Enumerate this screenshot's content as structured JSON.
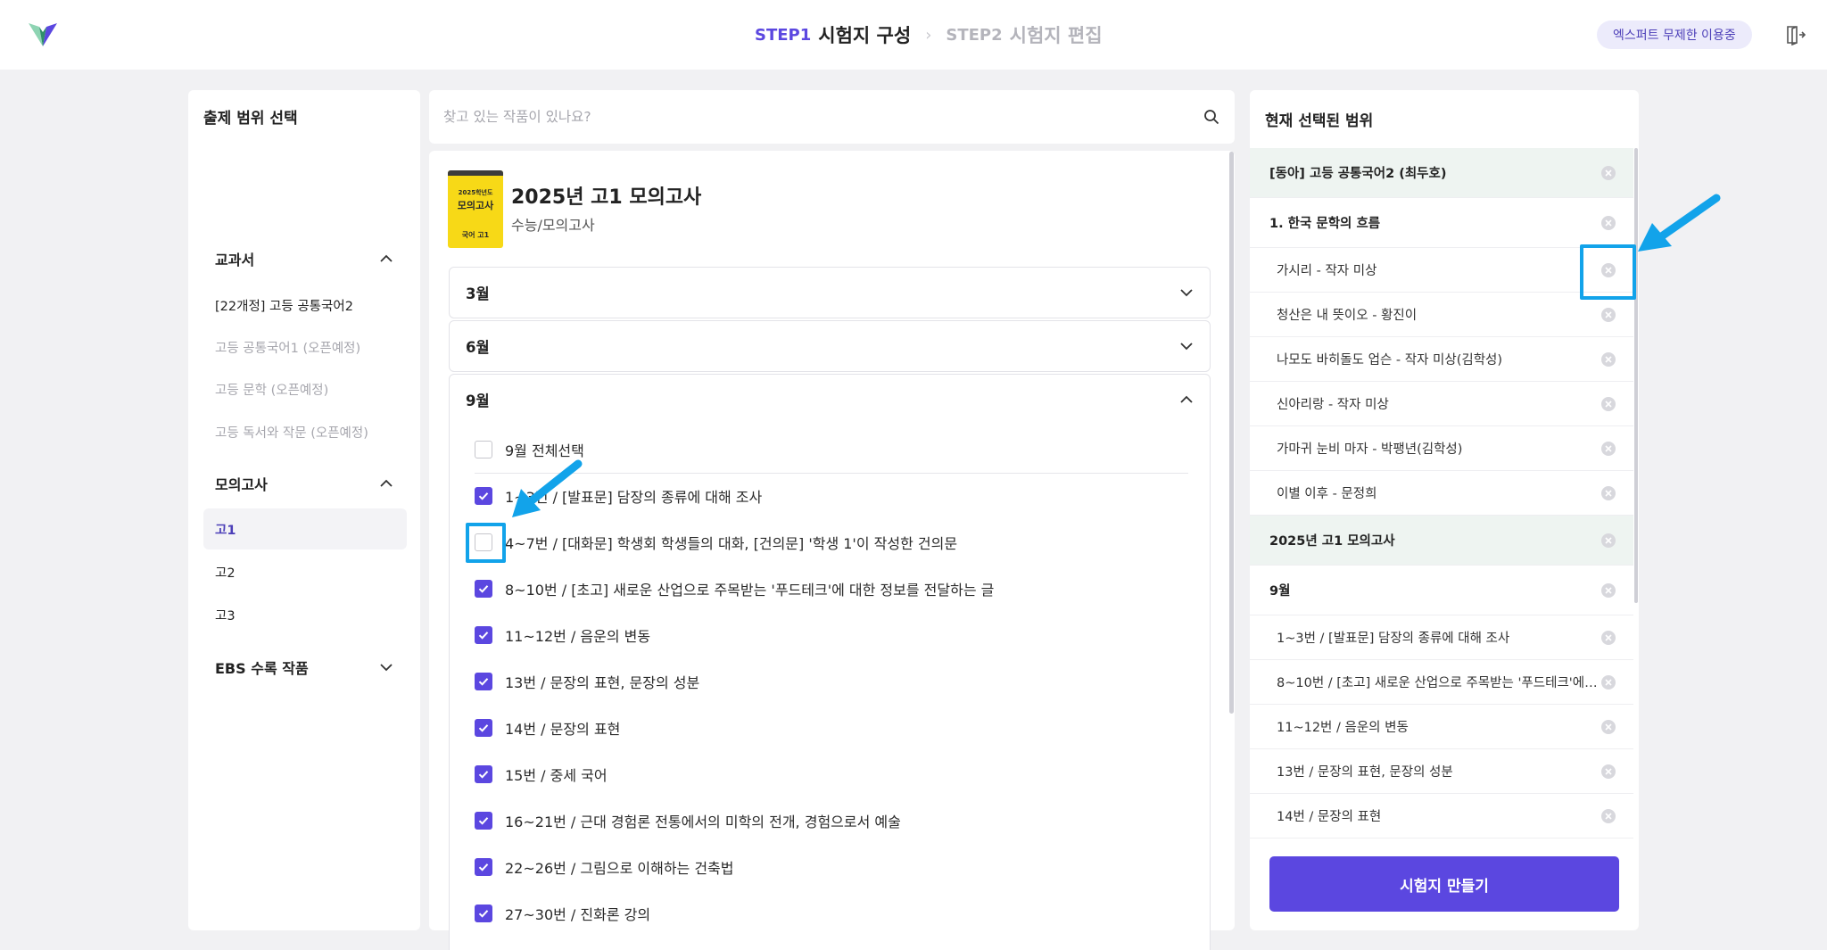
{
  "header": {
    "step1_num": "STEP1",
    "step1_label": "시험지 구성",
    "step2_num": "STEP2",
    "step2_label": "시험지 편집",
    "plan_badge": "엑스퍼트 무제한 이용중"
  },
  "left": {
    "title": "출제 범위 선택",
    "textbook_title": "교과서",
    "textbook_items": [
      "[22개정] 고등 공통국어2",
      "고등 공통국어1 (오픈예정)",
      "고등 문학 (오픈예정)",
      "고등 독서와 작문 (오픈예정)"
    ],
    "mock_title": "모의고사",
    "mock_items": [
      "고1",
      "고2",
      "고3"
    ],
    "ebs_title": "EBS 수록 작품"
  },
  "search": {
    "placeholder": "찾고 있는 작품이 있나요?"
  },
  "book": {
    "cover_top": "2025학년도",
    "cover_main": "모의고사",
    "cover_bottom": "국어  고1",
    "title": "2025년 고1 모의고사",
    "subtitle": "수능/모의고사"
  },
  "months": [
    {
      "label": "3월",
      "expanded": false
    },
    {
      "label": "6월",
      "expanded": false
    },
    {
      "label": "9월",
      "expanded": true
    }
  ],
  "september": {
    "select_all": "9월 전체선택",
    "items": [
      {
        "label": "1~3번 / [발표문] 담장의 종류에 대해 조사",
        "checked": true
      },
      {
        "label": "4~7번 / [대화문] 학생회 학생들의 대화, [건의문] '학생 1'이 작성한 건의문",
        "checked": false
      },
      {
        "label": "8~10번 / [초고] 새로운 산업으로 주목받는 '푸드테크'에 대한 정보를 전달하는 글",
        "checked": true
      },
      {
        "label": "11~12번 / 음운의 변동",
        "checked": true
      },
      {
        "label": "13번 / 문장의 표현, 문장의 성분",
        "checked": true
      },
      {
        "label": "14번 / 문장의 표현",
        "checked": true
      },
      {
        "label": "15번 / 중세 국어",
        "checked": true
      },
      {
        "label": "16~21번 / 근대 경험론 전통에서의 미학의 전개, 경험으로서 예술",
        "checked": true
      },
      {
        "label": "22~26번 / 그림으로 이해하는 건축법",
        "checked": true
      },
      {
        "label": "27~30번 / 진화론 강의",
        "checked": true
      }
    ]
  },
  "right": {
    "title": "현재 선택된 범위",
    "rows": [
      {
        "kind": "group",
        "text": "[동아] 고등 공통국어2 (최두호)"
      },
      {
        "kind": "section",
        "text": "1. 한국 문학의 흐름"
      },
      {
        "kind": "entry",
        "text": "가시리 - 작자 미상"
      },
      {
        "kind": "entry",
        "text": "청산은 내 뜻이오 - 황진이"
      },
      {
        "kind": "entry",
        "text": "나모도 바히돌도 업슨 - 작자 미상(김학성)"
      },
      {
        "kind": "entry",
        "text": "신아리랑 - 작자 미상"
      },
      {
        "kind": "entry",
        "text": "가마귀 눈비 마자 - 박팽년(김학성)"
      },
      {
        "kind": "entry",
        "text": "이별 이후 - 문정희"
      },
      {
        "kind": "group",
        "text": "2025년 고1 모의고사"
      },
      {
        "kind": "section",
        "text": "9월"
      },
      {
        "kind": "entry",
        "text": "1~3번 / [발표문] 담장의 종류에 대해 조사"
      },
      {
        "kind": "entry",
        "text": "8~10번 / [초고] 새로운 산업으로 주목받는 '푸드테크'에 ..."
      },
      {
        "kind": "entry",
        "text": "11~12번 / 음운의 변동"
      },
      {
        "kind": "entry",
        "text": "13번 / 문장의 표현, 문장의 성분"
      },
      {
        "kind": "entry",
        "text": "14번 / 문장의 표현"
      }
    ],
    "make_button": "시험지 만들기"
  },
  "colors": {
    "accent": "#5b47e0",
    "highlight": "#12a3ea",
    "group_bg": "#eef4f1"
  }
}
